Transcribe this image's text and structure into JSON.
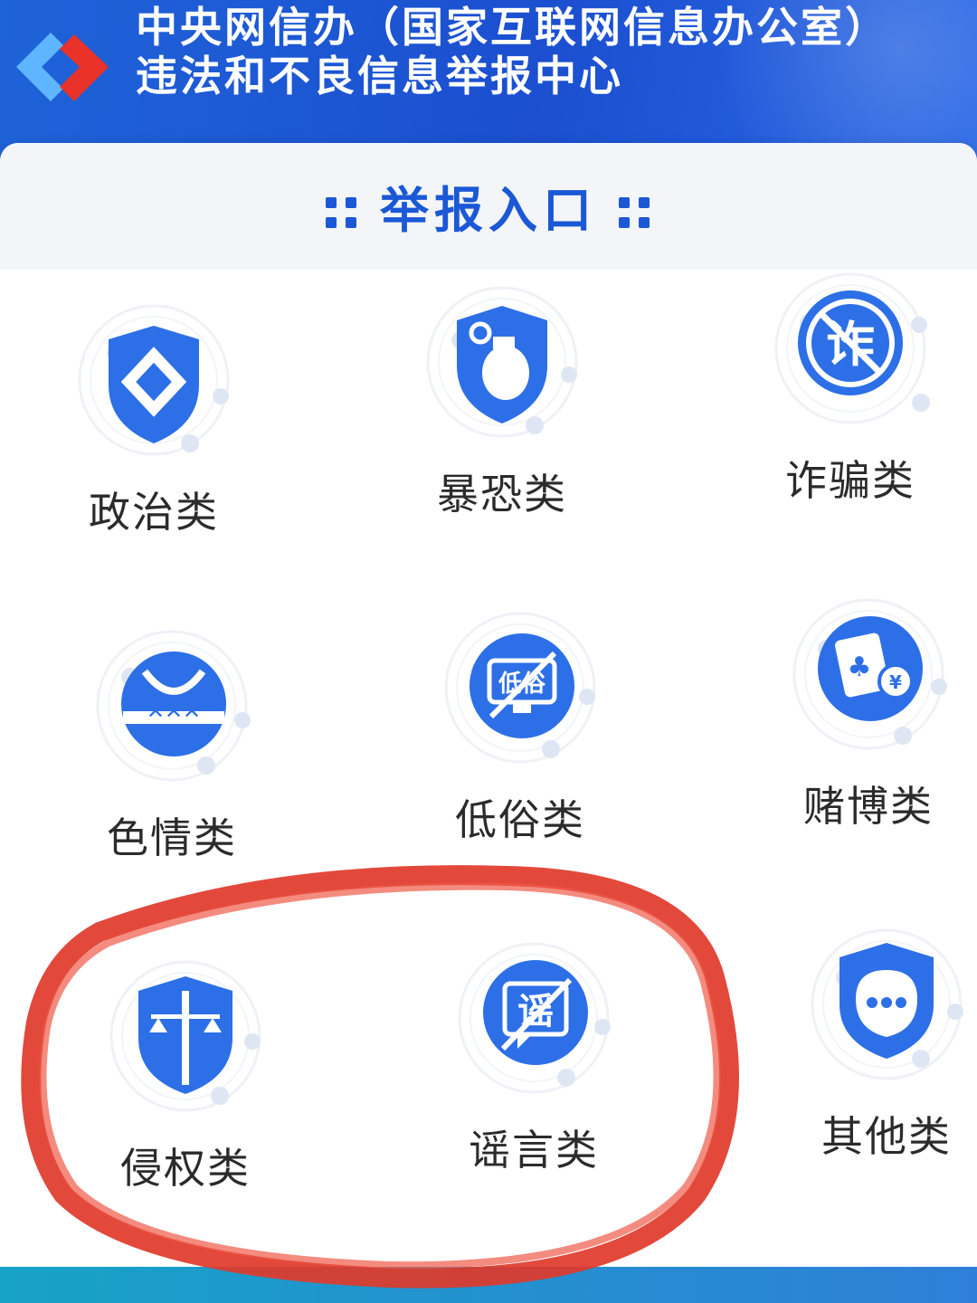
{
  "header": {
    "title_line1": "中央网信办（国家互联网信息办公室）",
    "title_line2": "违法和不良信息举报中心"
  },
  "section": {
    "title": "举报入口"
  },
  "categories": [
    {
      "label": "政治类",
      "icon": "shield-diamond-icon"
    },
    {
      "label": "暴恐类",
      "icon": "grenade-shield-icon"
    },
    {
      "label": "诈骗类",
      "icon": "no-fraud-icon",
      "glyph": "诈"
    },
    {
      "label": "色情类",
      "icon": "pornography-icon"
    },
    {
      "label": "低俗类",
      "icon": "vulgar-monitor-icon",
      "glyph": "低俗"
    },
    {
      "label": "赌博类",
      "icon": "gambling-cards-icon"
    },
    {
      "label": "侵权类",
      "icon": "scales-shield-icon"
    },
    {
      "label": "谣言类",
      "icon": "no-rumor-icon",
      "glyph": "谣"
    },
    {
      "label": "其他类",
      "icon": "other-shield-icon"
    }
  ],
  "colors": {
    "accent": "#1a58d6",
    "icon_blue": "#2d6fe6",
    "annotation_red": "#e03a2a"
  }
}
